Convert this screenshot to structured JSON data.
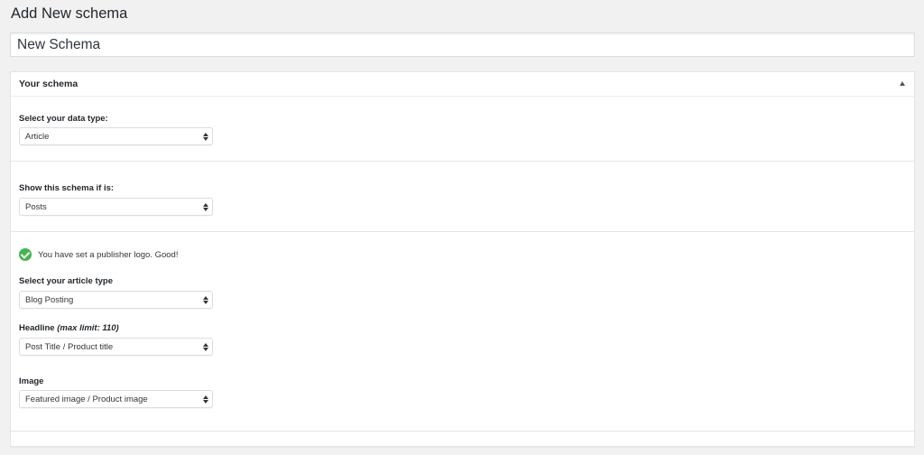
{
  "page": {
    "title": "Add New schema"
  },
  "title_input": {
    "value": "New Schema"
  },
  "metabox": {
    "title": "Your schema",
    "toggle_icon": "triangle-up-icon"
  },
  "fields": {
    "data_type": {
      "label": "Select your data type:",
      "value": "Article"
    },
    "show_if": {
      "label": "Show this schema if is:",
      "value": "Posts"
    },
    "notice": {
      "text": "You have set a publisher logo. Good!",
      "icon": "check-circle-icon",
      "color": "#46b450"
    },
    "article_type": {
      "label": "Select your article type",
      "value": "Blog Posting"
    },
    "headline": {
      "label": "Headline",
      "note": "(max limit: 110)",
      "value": "Post Title / Product title"
    },
    "image": {
      "label": "Image",
      "value": "Featured image / Product image"
    }
  }
}
